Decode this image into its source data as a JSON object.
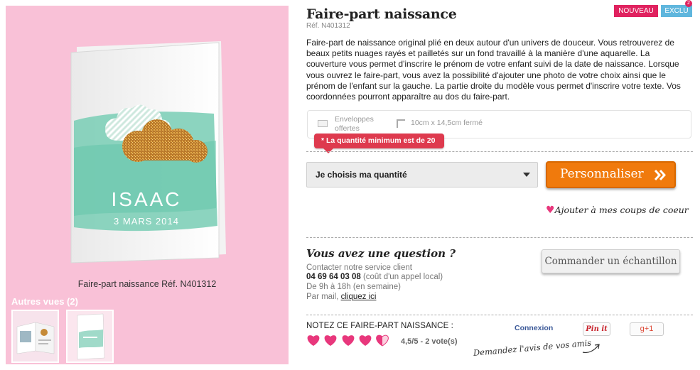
{
  "product": {
    "title": "Faire-part naissance",
    "ref": "Réf. N401312",
    "badges": {
      "new": "NOUVEAU",
      "exclusive": "EXCLU",
      "exclusive_marker": "2"
    },
    "description": "Faire-part de naissance original plié en deux autour d'un univers de douceur. Vous retrouverez de beaux petits nuages rayés et pailletés sur un fond travaillé à la manière d'une aquarelle. La couverture vous permet d'inscrire le prénom de votre enfant suivi de la date de naissance. Lorsque vous ouvrez le faire-part, vous avez la possibilité d'ajouter une photo de votre choix ainsi que le prénom de l'enfant sur la gauche. La partie droite du modèle vous permet d'inscrire votre texte. Vos coordonnées pourront apparaître au dos du faire-part."
  },
  "gallery": {
    "background": "#f9c1d7",
    "card_name": "ISAAC",
    "card_date": "3 MARS 2014",
    "caption": "Faire-part naissance Réf. N401312",
    "other_views": "Autres vues (2)"
  },
  "features": {
    "envelopes": "Enveloppes offertes",
    "format": "10cm x 14,5cm fermé"
  },
  "tooltip": "* La quantité minimum est de 20",
  "quantity": {
    "label": "Je choisis ma quantité"
  },
  "actions": {
    "personalize": "Personnaliser",
    "favorite": "Ajouter à mes coups de coeur",
    "sample": "Commander un échantillon"
  },
  "question": {
    "title": "Vous avez une question ?",
    "contact": "Contacter notre service client",
    "phone": "04 69 64 03 08",
    "phone_note": "(coût d'un appel local)",
    "hours": "De 9h à 18h (en semaine)",
    "mail_prefix": "Par mail,",
    "mail_link": "cliquez ici"
  },
  "rating": {
    "label": "NOTEZ CE FAIRE-PART NAISSANCE :",
    "score_text": "4,5/5 - 2 vote(s)",
    "score": 4.5,
    "max": 5,
    "color": "#e8377c"
  },
  "social": {
    "login": "Connexion",
    "pinit": "Pin it",
    "gplus": "g+1",
    "ask_friends": "Demandez l'avis de vos amis"
  },
  "colors": {
    "accent_pink": "#e0225f",
    "accent_blue": "#5fb6dd",
    "orange": "#f07a0c",
    "tooltip_red": "#de3a4e"
  }
}
